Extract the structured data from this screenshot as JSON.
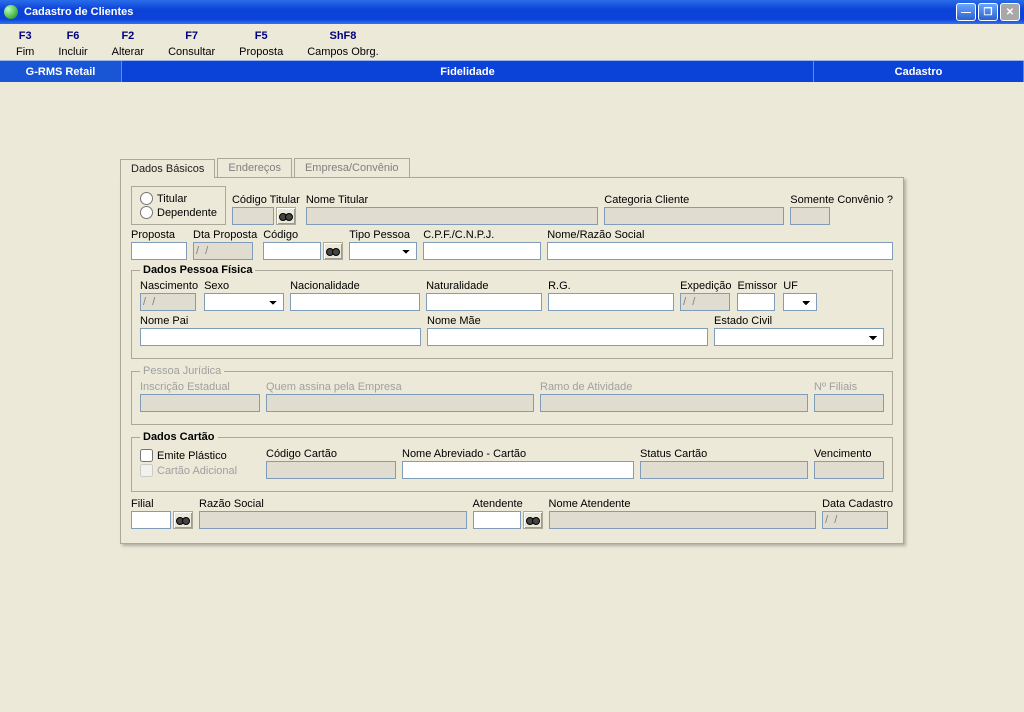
{
  "window": {
    "title": "Cadastro de Clientes"
  },
  "toolbar": [
    {
      "key": "F3",
      "label": "Fim"
    },
    {
      "key": "F6",
      "label": "Incluir"
    },
    {
      "key": "F2",
      "label": "Alterar"
    },
    {
      "key": "F7",
      "label": "Consultar"
    },
    {
      "key": "F5",
      "label": "Proposta"
    },
    {
      "key": "ShF8",
      "label": "Campos Obrg."
    }
  ],
  "panel": {
    "left": "G-RMS Retail",
    "center": "Fidelidade",
    "right": "Cadastro"
  },
  "tabs": {
    "t0": "Dados Básicos",
    "t1": "Endereços",
    "t2": "Empresa/Convênio"
  },
  "radios": {
    "titular": "Titular",
    "dependente": "Dependente"
  },
  "labels": {
    "codigo_titular": "Código Titular",
    "nome_titular": "Nome Titular",
    "categoria_cliente": "Categoria Cliente",
    "somente_convenio": "Somente Convênio ?",
    "proposta": "Proposta",
    "dta_proposta": "Dta Proposta",
    "codigo": "Código",
    "tipo_pessoa": "Tipo Pessoa",
    "cpf_cnpj": "C.P.F./C.N.P.J.",
    "nome_razao": "Nome/Razão Social",
    "grp_pf": "Dados Pessoa Física",
    "nascimento": "Nascimento",
    "sexo": "Sexo",
    "nacionalidade": "Nacionalidade",
    "naturalidade": "Naturalidade",
    "rg": "R.G.",
    "expedicao": "Expedição",
    "emissor": "Emissor",
    "uf": "UF",
    "nome_pai": "Nome Pai",
    "nome_mae": "Nome Mãe",
    "estado_civil": "Estado Civil",
    "grp_pj": "Pessoa Jurídica",
    "insc_estadual": "Inscrição Estadual",
    "quem_assina": "Quem assina pela Empresa",
    "ramo_atividade": "Ramo de Atividade",
    "n_filiais": "Nº Filiais",
    "grp_cartao": "Dados Cartão",
    "emite_plastico": "Emite Plástico",
    "cartao_adicional": "Cartão Adicional",
    "codigo_cartao": "Código Cartão",
    "nome_abrev": "Nome Abreviado - Cartão",
    "status_cartao": "Status Cartão",
    "vencimento": "Vencimento",
    "filial": "Filial",
    "razao_social": "Razão Social",
    "atendente": "Atendente",
    "nome_atendente": "Nome Atendente",
    "data_cadastro": "Data Cadastro"
  },
  "values": {
    "dta_proposta": "/  /",
    "nascimento": "/  /",
    "expedicao": "/  /",
    "data_cadastro": "/  /"
  }
}
